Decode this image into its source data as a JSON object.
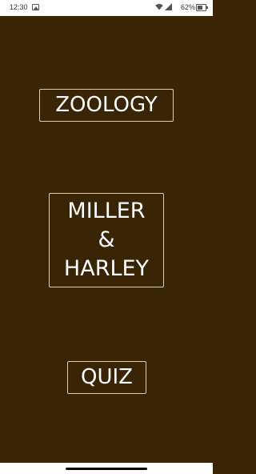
{
  "status_bar": {
    "time": "12:30",
    "battery_percent": "62%",
    "battery_level": 0.62,
    "icons": [
      "photo-icon",
      "wifi-icon",
      "signal-icon",
      "battery-icon"
    ]
  },
  "menu": {
    "zoology_label": "ZOOLOGY",
    "miller_lines": [
      "MILLER",
      "&",
      "HARLEY"
    ],
    "quiz_label": "QUIZ"
  },
  "colors": {
    "background": "#3a2406",
    "button_border": "#d8d0b0",
    "button_text": "#ffffff"
  }
}
